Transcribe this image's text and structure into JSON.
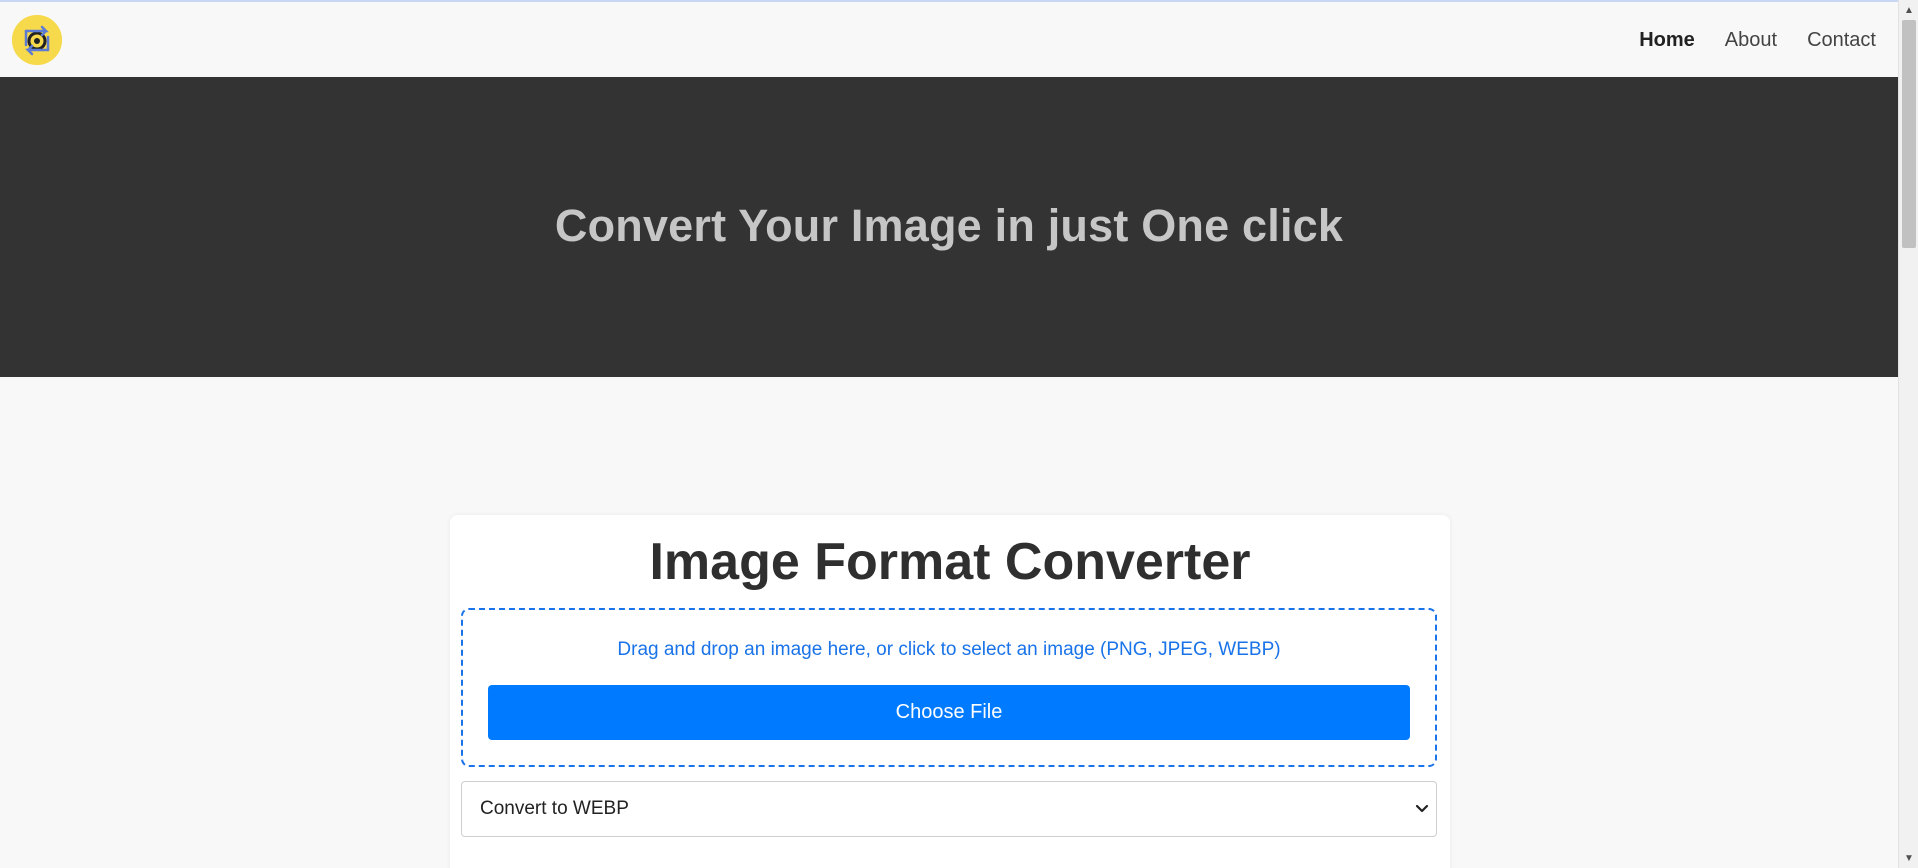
{
  "nav": {
    "logo_icon": "convert-arrows-logo",
    "items": [
      {
        "label": "Home",
        "active": true
      },
      {
        "label": "About",
        "active": false
      },
      {
        "label": "Contact",
        "active": false
      }
    ]
  },
  "hero": {
    "title": "Convert Your Image in just One click"
  },
  "converter": {
    "title": "Image Format Converter",
    "drop_text": "Drag and drop an image here, or click to select an image (PNG, JPEG, WEBP)",
    "choose_button_label": "Choose File",
    "format_select": {
      "selected": "Convert to WEBP"
    }
  },
  "colors": {
    "hero_bg": "#333333",
    "hero_text": "#c6c6c6",
    "accent": "#007bff",
    "drop_border": "#1a73e8",
    "logo_bg": "#f7d94c"
  }
}
